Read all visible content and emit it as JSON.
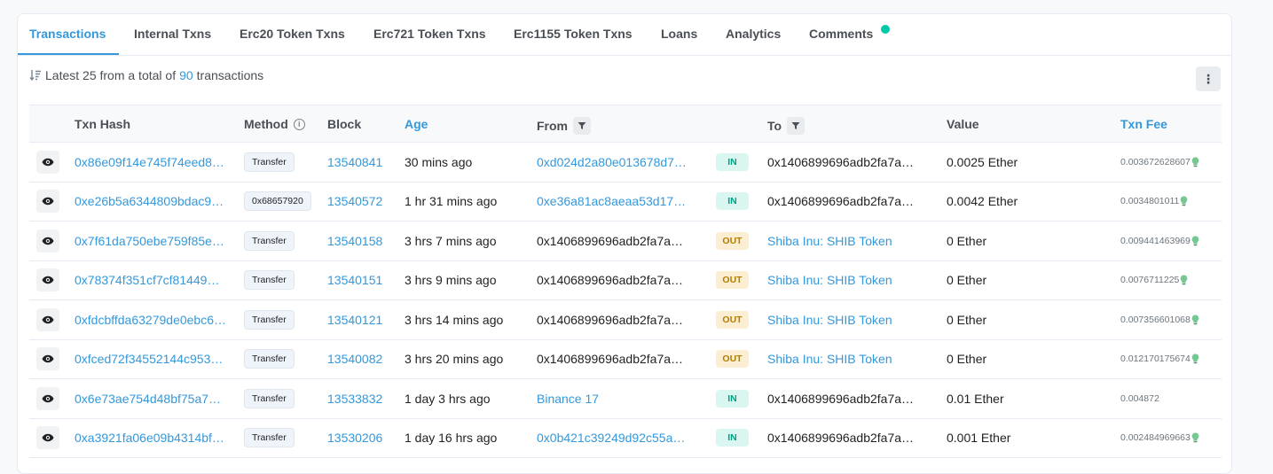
{
  "tabs": [
    {
      "label": "Transactions"
    },
    {
      "label": "Internal Txns"
    },
    {
      "label": "Erc20 Token Txns"
    },
    {
      "label": "Erc721 Token Txns"
    },
    {
      "label": "Erc1155 Token Txns"
    },
    {
      "label": "Loans"
    },
    {
      "label": "Analytics"
    },
    {
      "label": "Comments"
    }
  ],
  "summary": {
    "prefix": "Latest 25 from a total of",
    "count": "90",
    "suffix": "transactions"
  },
  "more_button": "⋮",
  "headers": {
    "txn_hash": "Txn Hash",
    "method": "Method",
    "block": "Block",
    "age": "Age",
    "from": "From",
    "to": "To",
    "value": "Value",
    "txn_fee": "Txn Fee"
  },
  "colors": {
    "accent": "#3498db",
    "in_badge": "#00a186",
    "out_badge": "#b47d00",
    "comments_dot": "#00c9a7"
  },
  "rows": [
    {
      "hash": "0x86e09f14e745f74eed8…",
      "method": "Transfer",
      "block": "13540841",
      "age": "30 mins ago",
      "from": "0xd024d2a80e013678d7…",
      "dir": "IN",
      "to": "0x1406899696adb2fa7a…",
      "value": "0.0025 Ether",
      "fee": "0.003672628607"
    },
    {
      "hash": "0xe26b5a6344809bdac9…",
      "method": "0x68657920",
      "block": "13540572",
      "age": "1 hr 31 mins ago",
      "from": "0xe36a81ac8aeaa53d17…",
      "dir": "IN",
      "to": "0x1406899696adb2fa7a…",
      "value": "0.0042 Ether",
      "fee": "0.0034801011"
    },
    {
      "hash": "0x7f61da750ebe759f85e…",
      "method": "Transfer",
      "block": "13540158",
      "age": "3 hrs 7 mins ago",
      "from": "0x1406899696adb2fa7a…",
      "dir": "OUT",
      "to": "Shiba Inu: SHIB Token",
      "value": "0 Ether",
      "fee": "0.009441463969"
    },
    {
      "hash": "0x78374f351cf7cf81449…",
      "method": "Transfer",
      "block": "13540151",
      "age": "3 hrs 9 mins ago",
      "from": "0x1406899696adb2fa7a…",
      "dir": "OUT",
      "to": "Shiba Inu: SHIB Token",
      "value": "0 Ether",
      "fee": "0.0076711225"
    },
    {
      "hash": "0xfdcbffda63279de0ebc6…",
      "method": "Transfer",
      "block": "13540121",
      "age": "3 hrs 14 mins ago",
      "from": "0x1406899696adb2fa7a…",
      "dir": "OUT",
      "to": "Shiba Inu: SHIB Token",
      "value": "0 Ether",
      "fee": "0.007356601068"
    },
    {
      "hash": "0xfced72f34552144c953…",
      "method": "Transfer",
      "block": "13540082",
      "age": "3 hrs 20 mins ago",
      "from": "0x1406899696adb2fa7a…",
      "dir": "OUT",
      "to": "Shiba Inu: SHIB Token",
      "value": "0 Ether",
      "fee": "0.012170175674"
    },
    {
      "hash": "0x6e73ae754d48bf75a7…",
      "method": "Transfer",
      "block": "13533832",
      "age": "1 day 3 hrs ago",
      "from": "Binance 17",
      "dir": "IN",
      "to": "0x1406899696adb2fa7a…",
      "value": "0.01 Ether",
      "fee": "0.004872"
    },
    {
      "hash": "0xa3921fa06e09b4314bf…",
      "method": "Transfer",
      "block": "13530206",
      "age": "1 day 16 hrs ago",
      "from": "0x0b421c39249d92c55a…",
      "dir": "IN",
      "to": "0x1406899696adb2fa7a…",
      "value": "0.001 Ether",
      "fee": "0.002484969663"
    }
  ],
  "row_flags": [
    {
      "from_link": true,
      "to_link": false,
      "bulb": true
    },
    {
      "from_link": true,
      "to_link": false,
      "bulb": true
    },
    {
      "from_link": false,
      "to_link": true,
      "bulb": true
    },
    {
      "from_link": false,
      "to_link": true,
      "bulb": true
    },
    {
      "from_link": false,
      "to_link": true,
      "bulb": true
    },
    {
      "from_link": false,
      "to_link": true,
      "bulb": true
    },
    {
      "from_link": true,
      "to_link": false,
      "bulb": false
    },
    {
      "from_link": true,
      "to_link": false,
      "bulb": true
    }
  ]
}
